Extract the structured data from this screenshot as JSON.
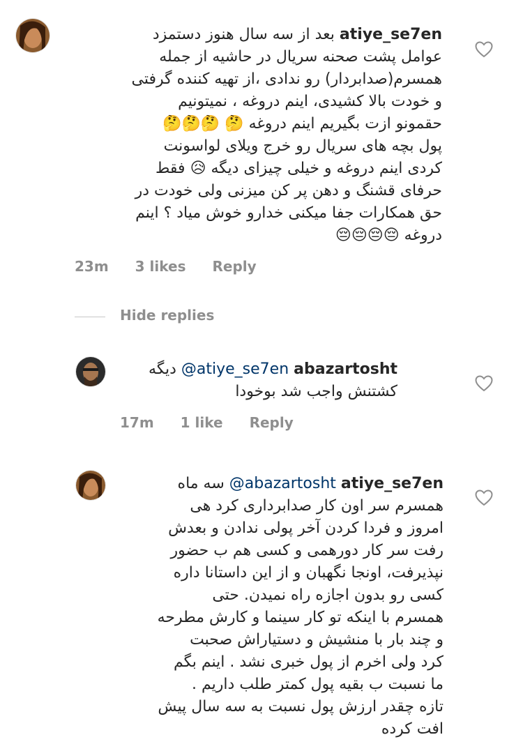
{
  "comments": [
    {
      "username": "atiye_se7en",
      "lines": [
        "بعد از سه سال هنوز دستمزد",
        "عوامل پشت صحنه سریال در حاشیه از جمله",
        "همسرم(صدابردار) رو ندادی ،از تهیه کننده گرفتی",
        "و خودت بالا کشیدی، اینم دروغه ، نمیتونیم",
        "حقمونو ازت بگیریم اینم دروغه 🤔 🤔🤔🤔",
        "پول بچه های سریال رو خرج ویلای لواسونت",
        "کردی اینم دروغه و خیلی چیزای دیگه 😥 فقط",
        "حرفای قشنگ و دهن پر کن میزنی ولی خودت در",
        "حق همکارات جفا میکنی خدارو خوش میاد ؟ اینم",
        "دروغه 😔😔😔😔"
      ],
      "time": "23m",
      "likes": "3 likes",
      "reply": "Reply"
    },
    {
      "username": "abazartosht",
      "mention": "@atiye_se7en",
      "lines": [
        "دیگه",
        "کشتنش واجب شد بوخودا"
      ],
      "time": "17m",
      "likes": "1 like",
      "reply": "Reply"
    },
    {
      "username": "atiye_se7en",
      "mention": "@abazartosht",
      "lines": [
        "سه ماه",
        "همسرم سر اون کار صدابرداری کرد هی",
        "امروز و فردا کردن آخر پولی ندادن و بعدش",
        "رفت سر کار دورهمی و کسی هم ب حضور",
        "نپذیرفت، اونجا نگهبان و از این داستانا داره",
        "کسی رو بدون اجازه راه نمیدن. حتی",
        "همسرم با اینکه تو کار سینما و کارش مطرحه",
        "و چند بار با منشیش و دستیاراش صحبت",
        "کرد ولی اخرم از پول خبری نشد . اینم بگم",
        "ما نسبت ب بقیه پول کمتر طلب داریم .",
        "تازه چقدر ارزش پول نسبت به سه سال پیش",
        "افت کرده"
      ]
    }
  ],
  "hide_replies": "Hide replies",
  "icons": {
    "like": "heart-outline-icon"
  },
  "colors": {
    "meta": "#8e8e8e",
    "mention": "#003569",
    "text": "#262626"
  }
}
